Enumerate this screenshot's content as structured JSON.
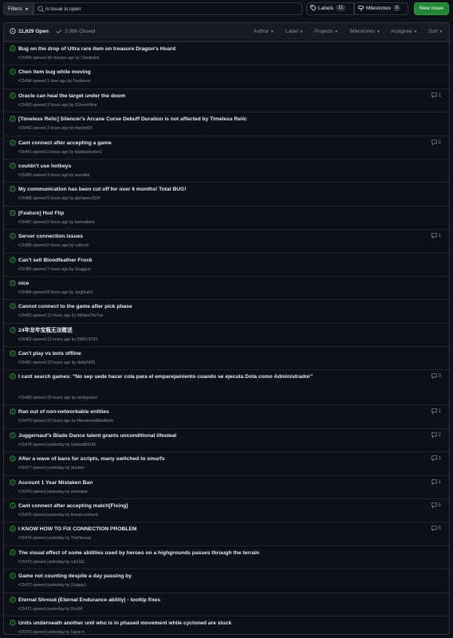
{
  "topbar": {
    "filters_label": "Filters",
    "search_value": "is:issue is:open",
    "labels_label": "Labels",
    "labels_count": "11",
    "milestones_label": "Milestones",
    "milestones_count": "0",
    "new_issue_label": "New issue"
  },
  "header": {
    "open_label": "11,629 Open",
    "closed_label": "3,066 Closed",
    "filters": [
      "Author",
      "Label",
      "Projects",
      "Milestones",
      "Assignee",
      "Sort"
    ]
  },
  "colors": {
    "open": "#3fb950",
    "accent": "#238636"
  },
  "issues": [
    {
      "title": "Bug on the drop of Ultra rare item on treasure Dragon's Hoard",
      "meta": "#15495 opened 49 minutes ago by Chelarden",
      "comments": ""
    },
    {
      "title": "Chen item bug while moving",
      "meta": "#15494 opened 1 hour ago by Truekoros",
      "comments": ""
    },
    {
      "title": "Oracle can heal the target under the doom",
      "meta": "#15493 opened 2 hours ago by GGreenNine",
      "comments": "1"
    },
    {
      "title": "[Timeless Relic] Silencer's Arcane Curse Debuff Duration is not affected by Timeless Relic",
      "meta": "#15492 opened 2 hours ago by etamint93",
      "comments": ""
    },
    {
      "title": "Cant connect after accepting a game",
      "meta": "#15491 opened 3 hours ago by dogfacetanker1",
      "comments": "2"
    },
    {
      "title": "couldn't use hotkeys",
      "meta": "#15489 opened 4 hours ago by secraltar",
      "comments": ""
    },
    {
      "title": "My communication has been cut off for over 6 months! Total BUG!",
      "meta": "#15488 opened 5 hours ago by aprhanns2024",
      "comments": ""
    },
    {
      "title": "[Feature] Hud Flip",
      "meta": "#15487 opened 6 hours ago by hamzabetd",
      "comments": ""
    },
    {
      "title": "Server connection issues",
      "meta": "#15486 opened 6 hours ago by cullerutt",
      "comments": "1"
    },
    {
      "title": "Can't sell Bloodfeather Frock",
      "meta": "#15485 opened 7 hours ago by Souggun",
      "comments": ""
    },
    {
      "title": "nice",
      "meta": "#15484 opened 8 hours ago by Jarg0vek1",
      "comments": ""
    },
    {
      "title": "Cannot connect to the game after pick phase",
      "meta": "#15483 opened 12 hours ago by WilliamTheToe",
      "comments": ""
    },
    {
      "title": "24年龙年宝瓶无法赠送",
      "meta": "#15482 opened 13 hours ago by 59B974723",
      "comments": ""
    },
    {
      "title": "Can't play vs bots offline",
      "meta": "#15481 opened 13 hours ago by vlady0425",
      "comments": ""
    },
    {
      "title": "I cant search games: \"No sep uede hacer cola para el emparejamiento cuando se ejecuta Dota como Administrador\"",
      "meta": "#15480 opened 20 hours ago by randyyosen",
      "comments": "3"
    },
    {
      "title": "Ran out of non-networkable entities",
      "meta": "#15479 opened 20 hours ago by MarvelousMissMarin",
      "comments": "1"
    },
    {
      "title": "Juggernaut's Blade Dance talent grants unconditional lifesteal",
      "meta": "#15478 opened yesterday by Undead84106",
      "comments": "2"
    },
    {
      "title": "After a wave of bans for scripts, many switched to smurfs",
      "meta": "#15477 opened yesterday by Sunlam",
      "comments": "1"
    },
    {
      "title": "Account 1 Year Mistaken Ban",
      "meta": "#15476 opened yesterday by mermarie",
      "comments": "1"
    },
    {
      "title": "Cant connect after accepting match[Fixing]",
      "meta": "#15475 opened yesterday by AnnieLeonhard",
      "comments": "5"
    },
    {
      "title": "I KNOW HOW TO FIX CONNECTION PROBLEM",
      "meta": "#15474 opened yesterday by TheHeesay",
      "comments": "5"
    },
    {
      "title": "The visual effect of some abilities used by heroes on a highgrounds passes through the terrain",
      "meta": "#15473 opened yesterday by cut1311",
      "comments": ""
    },
    {
      "title": "Game not counting despite a day passing by",
      "meta": "#15472 opened yesterday by Zaoppy1",
      "comments": ""
    },
    {
      "title": "Eternal Shroud (Eternal Endurance ability) - tooltip fixes",
      "meta": "#15471 opened yesterday by Dov04",
      "comments": ""
    },
    {
      "title": "Units underneath another unit who is in phased movement while cycloned are stuck",
      "meta": "#15470 opened yesterday by Fjace-h",
      "comments": ""
    }
  ]
}
